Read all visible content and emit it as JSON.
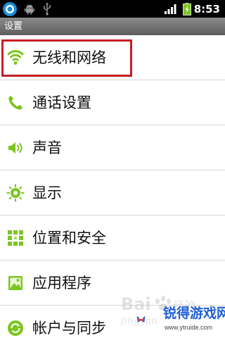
{
  "status_bar": {
    "time": "8:53",
    "icons": [
      "app-icon",
      "android-icon",
      "usb-icon",
      "signal-icon",
      "battery-icon"
    ]
  },
  "header": {
    "title": "设置"
  },
  "settings": {
    "items": [
      {
        "label": "无线和网络",
        "icon": "wifi-icon",
        "highlighted": true
      },
      {
        "label": "通话设置",
        "icon": "phone-icon"
      },
      {
        "label": "声音",
        "icon": "speaker-icon"
      },
      {
        "label": "显示",
        "icon": "brightness-icon"
      },
      {
        "label": "位置和安全",
        "icon": "location-security-icon"
      },
      {
        "label": "应用程序",
        "icon": "applications-icon"
      },
      {
        "label": "帐户与同步",
        "icon": "sync-icon"
      }
    ]
  },
  "watermark": {
    "brand": "锐得游戏网",
    "url": "www.ytruide.com",
    "baidu": "Baidu经验"
  },
  "colors": {
    "icon_green": "#7cc520",
    "highlight_red": "#c41f24",
    "status_bar": "#000000",
    "title_bar": "#6e6e6e"
  }
}
